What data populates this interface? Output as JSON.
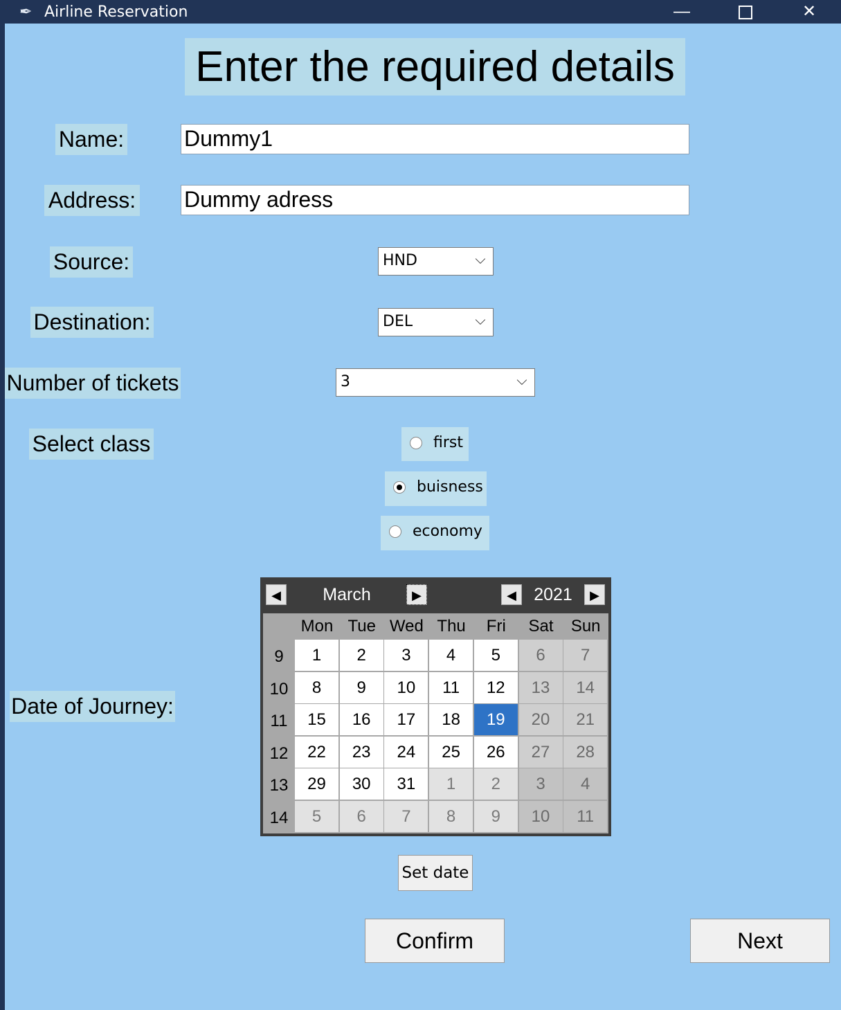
{
  "window": {
    "title": "Airline Reservation",
    "minimize_glyph": "—",
    "close_glyph": "✕"
  },
  "form": {
    "heading": "Enter the required details",
    "name_label": "Name:",
    "name_value": "Dummy1",
    "address_label": "Address:",
    "address_value": "Dummy adress",
    "source_label": "Source:",
    "source_value": "HND",
    "destination_label": "Destination:",
    "destination_value": "DEL",
    "tickets_label": "Number of tickets",
    "tickets_value": "3",
    "class_label": "Select class",
    "class_options": [
      {
        "label": "first",
        "selected": false
      },
      {
        "label": "buisness",
        "selected": true
      },
      {
        "label": "economy",
        "selected": false
      }
    ],
    "date_label": "Date of Journey:"
  },
  "calendar": {
    "month": "March",
    "year": "2021",
    "prev_glyph": "◀",
    "next_glyph": "▶",
    "day_headers": [
      "Mon",
      "Tue",
      "Wed",
      "Thu",
      "Fri",
      "Sat",
      "Sun"
    ],
    "selected_day": 19,
    "weeks": [
      {
        "number": "9",
        "days": [
          1,
          2,
          3,
          4,
          5,
          6,
          7
        ]
      },
      {
        "number": "10",
        "days": [
          8,
          9,
          10,
          11,
          12,
          13,
          14
        ]
      },
      {
        "number": "11",
        "days": [
          15,
          16,
          17,
          18,
          19,
          20,
          21
        ]
      },
      {
        "number": "12",
        "days": [
          22,
          23,
          24,
          25,
          26,
          27,
          28
        ]
      },
      {
        "number": "13",
        "days": [
          29,
          30,
          31,
          1,
          2,
          3,
          4
        ]
      },
      {
        "number": "14",
        "days": [
          5,
          6,
          7,
          8,
          9,
          10,
          11
        ]
      }
    ]
  },
  "buttons": {
    "set_date": "Set date",
    "confirm": "Confirm",
    "next": "Next"
  },
  "colors": {
    "background": "#99caf2",
    "titlebar": "#213456",
    "label_bg": "#b6dbea",
    "calendar_selected": "#2e73c6"
  },
  "icons": {
    "combo_arrow": "chevron-down-icon",
    "window_icon": "feather-icon"
  }
}
